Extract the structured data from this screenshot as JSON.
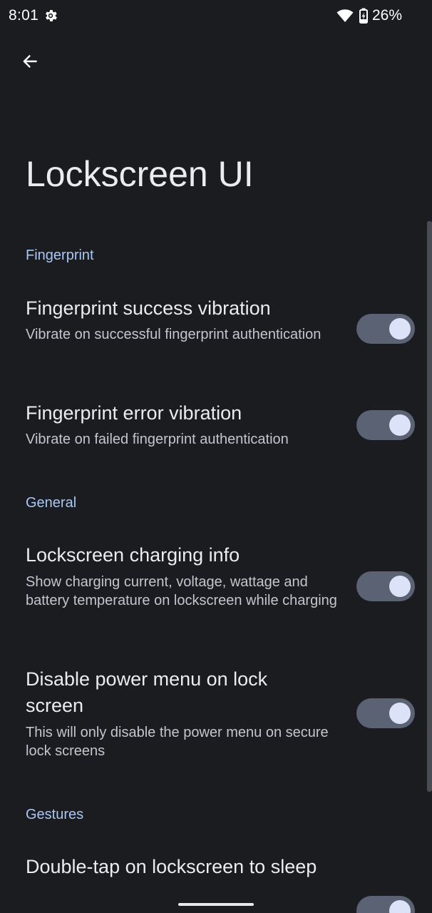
{
  "status_bar": {
    "time": "8:01",
    "battery_percent": "26%",
    "icons": [
      "gear-icon",
      "wifi-icon",
      "battery-charging-icon"
    ]
  },
  "header": {
    "back_icon": "arrow-back-icon",
    "title": "Lockscreen UI"
  },
  "sections": [
    {
      "header": "Fingerprint",
      "items": [
        {
          "title": "Fingerprint success vibration",
          "summary": "Vibrate on successful fingerprint authentication",
          "enabled": true
        },
        {
          "title": "Fingerprint error vibration",
          "summary": "Vibrate on failed fingerprint authentication",
          "enabled": true
        }
      ]
    },
    {
      "header": "General",
      "items": [
        {
          "title": "Lockscreen charging info",
          "summary": "Show charging current, voltage, wattage and battery temperature on lockscreen while charging",
          "enabled": true
        },
        {
          "title": "Disable power menu on lock screen",
          "summary": "This will only disable the power menu on secure lock screens",
          "enabled": true
        }
      ]
    },
    {
      "header": "Gestures",
      "items": [
        {
          "title": "Double-tap on lockscreen to sleep",
          "summary": "",
          "enabled": true
        }
      ]
    }
  ],
  "colors": {
    "background": "#1b1c20",
    "accent": "#a9c7f5",
    "toggle_track": "#5b6274",
    "toggle_thumb": "#dce2f7"
  }
}
